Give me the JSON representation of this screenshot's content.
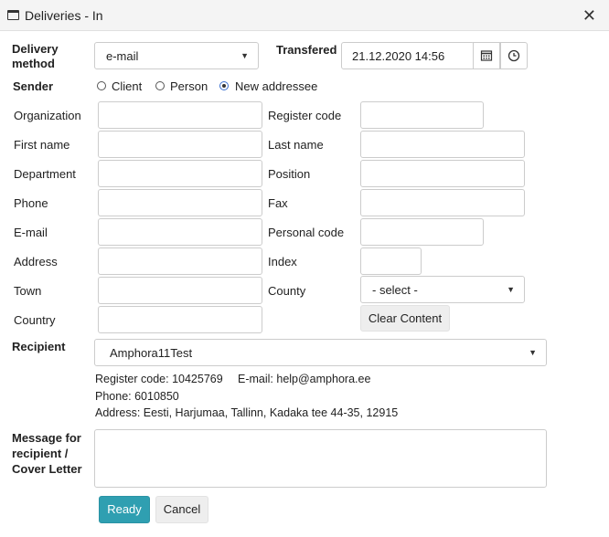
{
  "window": {
    "title": "Deliveries - In"
  },
  "delivery": {
    "label_line1": "Delivery",
    "label_line2": "method",
    "value": "e-mail",
    "transfered_label": "Transfered",
    "transfered_value": "21.12.2020 14:56"
  },
  "sender": {
    "label": "Sender",
    "options": [
      "Client",
      "Person",
      "New addressee"
    ],
    "selected": "New addressee"
  },
  "fields": {
    "organization": "Organization",
    "register_code": "Register code",
    "first_name": "First name",
    "last_name": "Last name",
    "department": "Department",
    "position": "Position",
    "phone": "Phone",
    "fax": "Fax",
    "email": "E-mail",
    "personal_code": "Personal code",
    "address": "Address",
    "index": "Index",
    "town": "Town",
    "county": "County",
    "county_value": "- select -",
    "country": "Country",
    "clear_content": "Clear Content"
  },
  "recipient": {
    "label": "Recipient",
    "value": "Amphora11Test",
    "register_code": "Register code: 10425769",
    "email": "E-mail: help@amphora.ee",
    "phone": "Phone: 6010850",
    "address": "Address: Eesti, Harjumaa, Tallinn, Kadaka tee 44-35, 12915"
  },
  "message": {
    "line1": "Message for",
    "line2": "recipient /",
    "line3": "Cover Letter"
  },
  "actions": {
    "ready": "Ready",
    "cancel": "Cancel"
  }
}
